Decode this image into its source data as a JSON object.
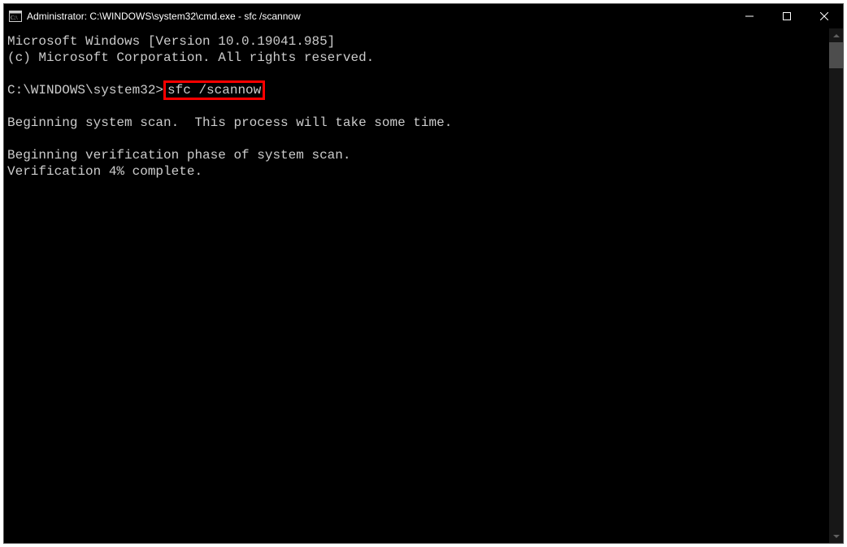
{
  "titlebar": {
    "title": "Administrator: C:\\WINDOWS\\system32\\cmd.exe - sfc  /scannow"
  },
  "terminal": {
    "line1": "Microsoft Windows [Version 10.0.19041.985]",
    "line2": "(c) Microsoft Corporation. All rights reserved.",
    "blank": "",
    "prompt": "C:\\WINDOWS\\system32>",
    "highlighted_command": "sfc /scannow",
    "line4": "Beginning system scan.  This process will take some time.",
    "line5": "Beginning verification phase of system scan.",
    "line6": "Verification 4% complete."
  }
}
